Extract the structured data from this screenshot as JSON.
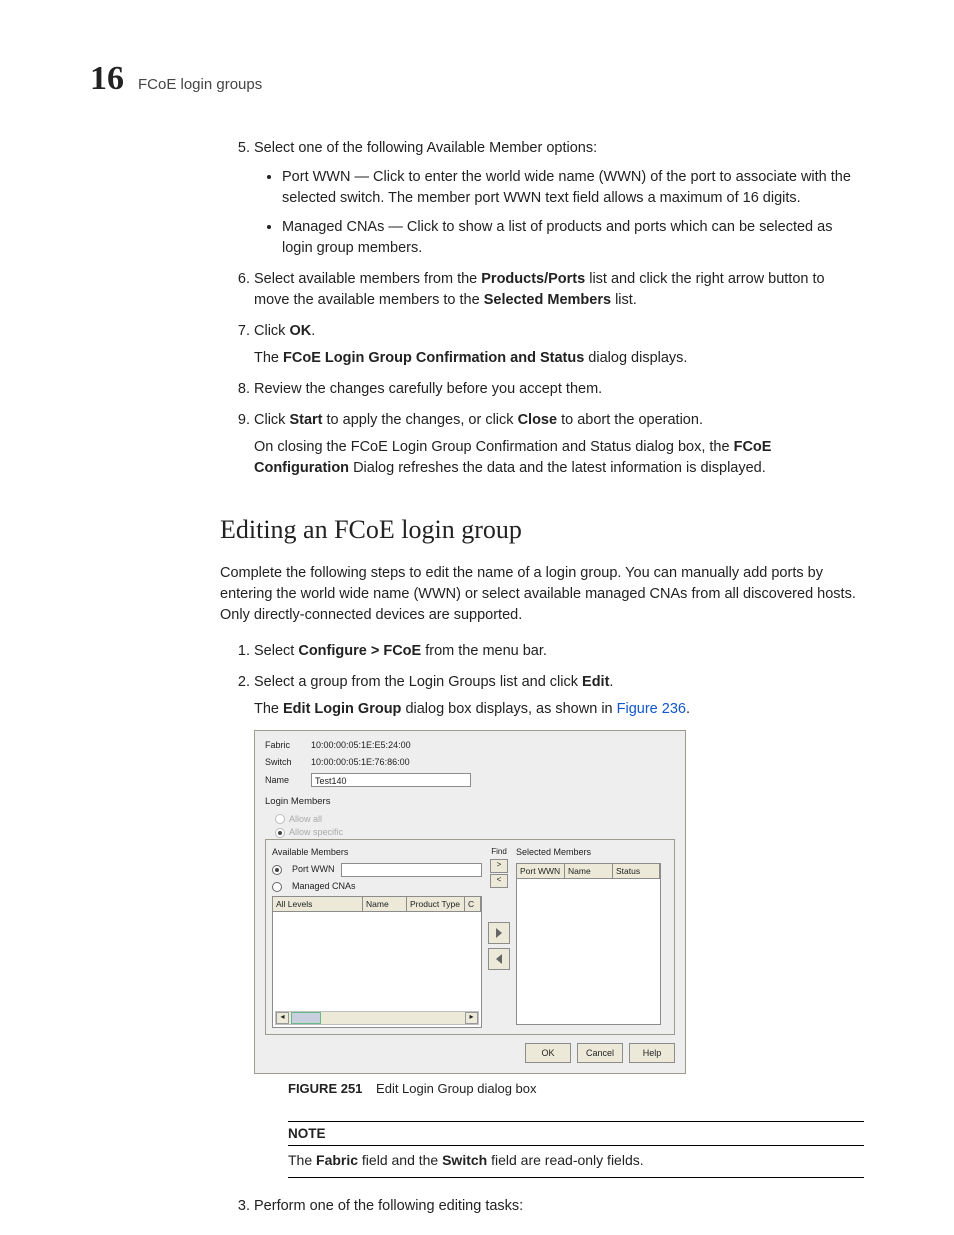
{
  "chapter_number": "16",
  "running_title": "FCoE login groups",
  "steps_a": {
    "s5": "Select one of the following Available Member options:",
    "s5_bullets": [
      {
        "lead": "Port WWN",
        "rest": " — Click to enter the world wide name (WWN) of the port to associate with the selected switch. The member port WWN text field allows a maximum of 16 digits."
      },
      {
        "lead": "Managed CNAs",
        "rest": " — Click to show a list of products and ports which can be selected as login group members."
      }
    ],
    "s6_a": "Select available members from the ",
    "s6_b": "Products/Ports",
    "s6_c": " list and click the right arrow button to move the available members to the ",
    "s6_d": "Selected Members",
    "s6_e": " list.",
    "s7_a": "Click ",
    "s7_b": "OK",
    "s7_c": ".",
    "s7_p_a": "The ",
    "s7_p_b": "FCoE Login Group Confirmation and Status",
    "s7_p_c": " dialog displays.",
    "s8": "Review the changes carefully before you accept them.",
    "s9_a": "Click ",
    "s9_b": "Start",
    "s9_c": " to apply the changes, or click ",
    "s9_d": "Close",
    "s9_e": " to abort the operation.",
    "s9_p_a": "On closing the FCoE Login Group Confirmation and Status dialog box, the ",
    "s9_p_b": "FCoE Configuration",
    "s9_p_c": " Dialog refreshes the data and the latest information is displayed."
  },
  "section_h2": "Editing an FCoE login group",
  "section_intro": "Complete the following steps to edit the name of a login group. You can manually add ports by entering the world wide name (WWN) or select available managed CNAs from all discovered hosts. Only directly-connected devices are supported.",
  "steps_b": {
    "s1_a": "Select ",
    "s1_b": "Configure > FCoE",
    "s1_c": " from the menu bar.",
    "s2_a": "Select a group from the Login Groups list and click ",
    "s2_b": "Edit",
    "s2_c": ".",
    "s2_p_a": "The ",
    "s2_p_b": "Edit Login Group",
    "s2_p_c": " dialog box displays, as shown in ",
    "s2_link": "Figure 236",
    "s2_p_d": "."
  },
  "figure": {
    "caption_lead": "FIGURE 251",
    "caption_text": "Edit Login Group dialog box",
    "labels": {
      "fabric": "Fabric",
      "switch": "Switch",
      "name": "Name"
    },
    "fabric": "10:00:00:05:1E:E5:24:00",
    "switch": "10:00:00:05:1E:76:86:00",
    "name": "Test140",
    "login_members": "Login Members",
    "allow_all": "Allow all",
    "allow_specific": "Allow specific",
    "available_members": "Available Members",
    "port_wwn": "Port WWN",
    "managed_cnas": "Managed CNAs",
    "cols_avail": {
      "c1": "All Levels",
      "c2": "Name",
      "c3": "Product Type",
      "c4": "C"
    },
    "find": "Find",
    "selected_members": "Selected Members",
    "cols_sel": {
      "c1": "Port WWN",
      "c2": "Name",
      "c3": "Status"
    },
    "buttons": {
      "ok": "OK",
      "cancel": "Cancel",
      "help": "Help"
    }
  },
  "note": {
    "heading": "NOTE",
    "body_a": "The ",
    "body_b": "Fabric",
    "body_c": " field and the ",
    "body_d": "Switch",
    "body_e": " field are read-only fields."
  },
  "step3": "Perform one of the following editing tasks:"
}
